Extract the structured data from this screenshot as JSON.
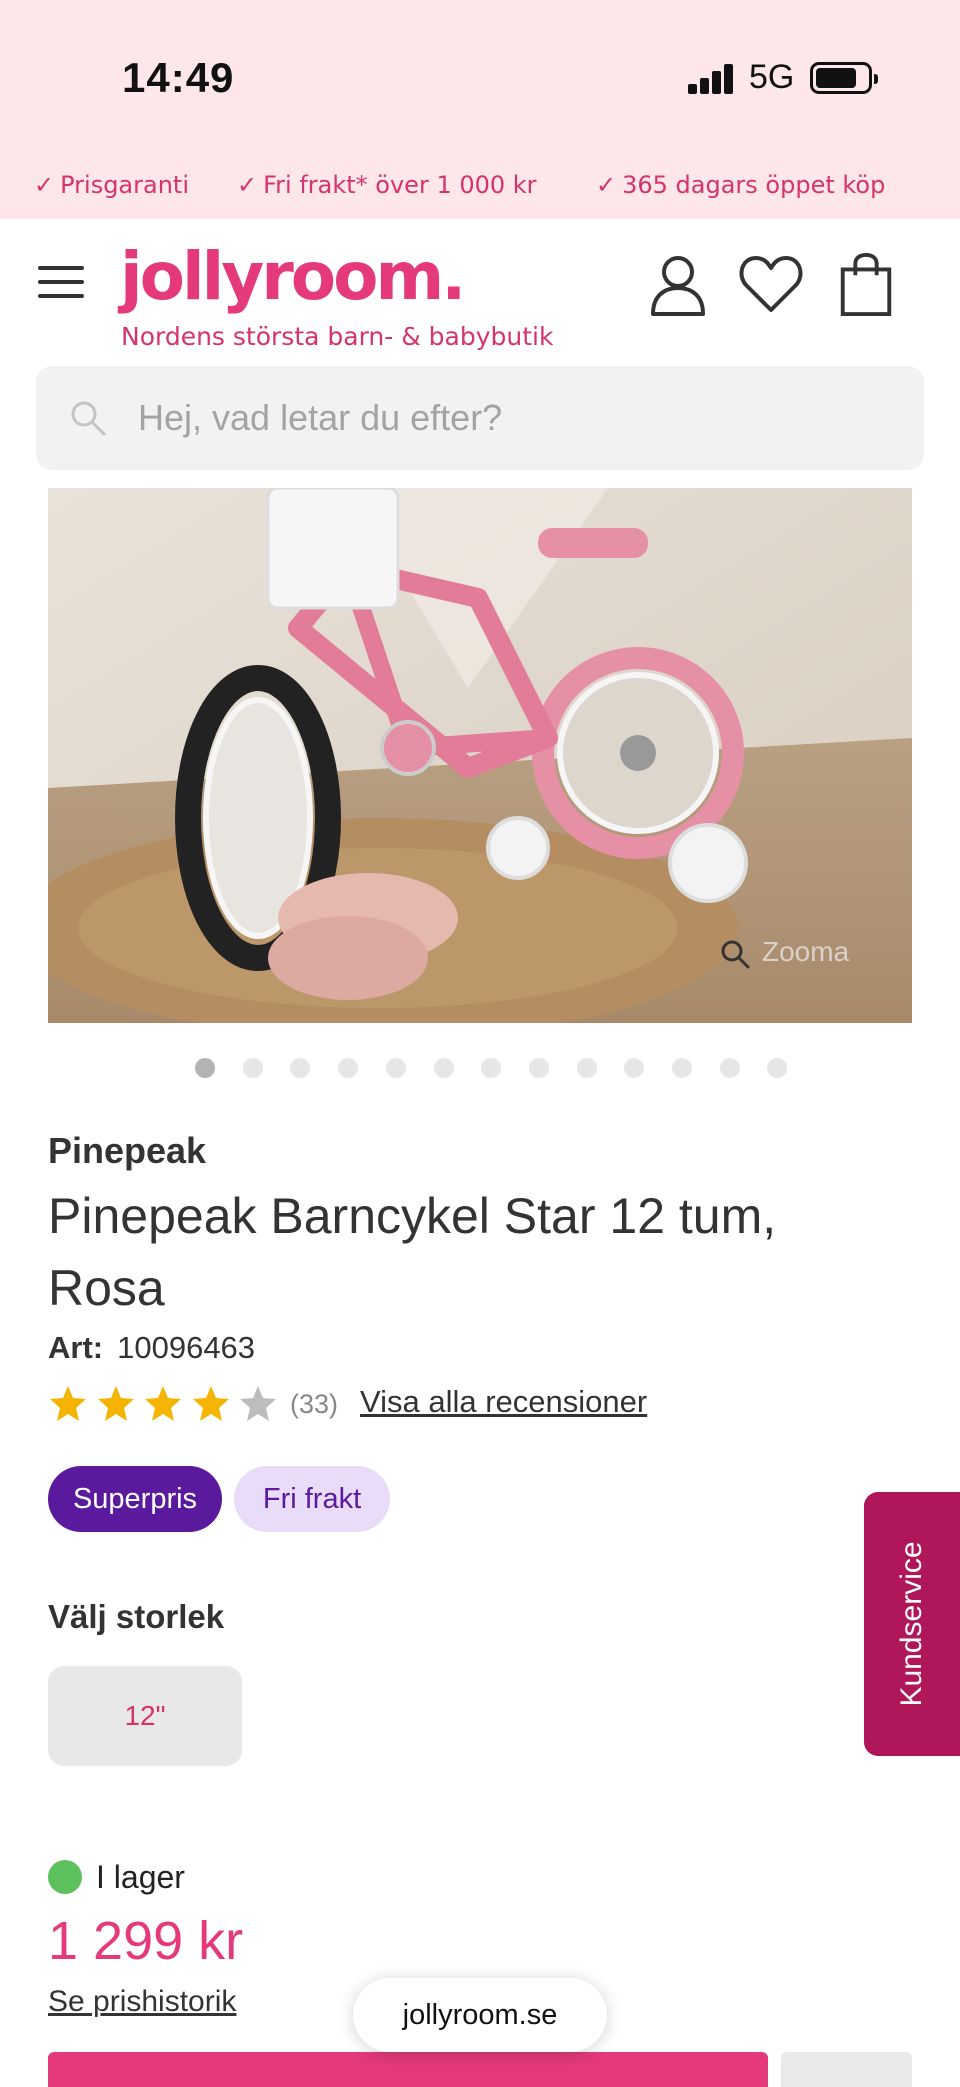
{
  "status_bar": {
    "time": "14:49",
    "network": "5G"
  },
  "usps": [
    {
      "check": "✓",
      "text": "Prisgaranti"
    },
    {
      "check": "✓",
      "text": "Fri frakt* över 1 000 kr"
    },
    {
      "check": "✓",
      "text": "365 dagars öppet köp"
    }
  ],
  "header": {
    "logo": "jollyroom.",
    "tagline": "Nordens största barn- & babybutik"
  },
  "search": {
    "placeholder": "Hej, vad letar du efter?"
  },
  "gallery": {
    "zoom_label": "Zooma",
    "image_count": 13,
    "active_index": 0
  },
  "product": {
    "brand": "Pinepeak",
    "title": "Pinepeak Barncykel Star 12 tum, Rosa",
    "art_label": "Art:",
    "art_number": "10096463",
    "rating": 4,
    "review_count": "(33)",
    "reviews_link": "Visa alla recensioner",
    "badges": {
      "super": "Superpris",
      "frakt": "Fri frakt"
    },
    "size_label": "Välj storlek",
    "size_option": "12\"",
    "stock_text": "I lager",
    "price": "1 299 kr",
    "price_history": "Se prishistorik"
  },
  "browser": {
    "url": "jollyroom.se"
  },
  "kundservice": "Kundservice",
  "colors": {
    "accent": "#e4397a",
    "purple": "#5b1a9e",
    "stock": "#5cc05c",
    "banner": "#fde7ea"
  }
}
